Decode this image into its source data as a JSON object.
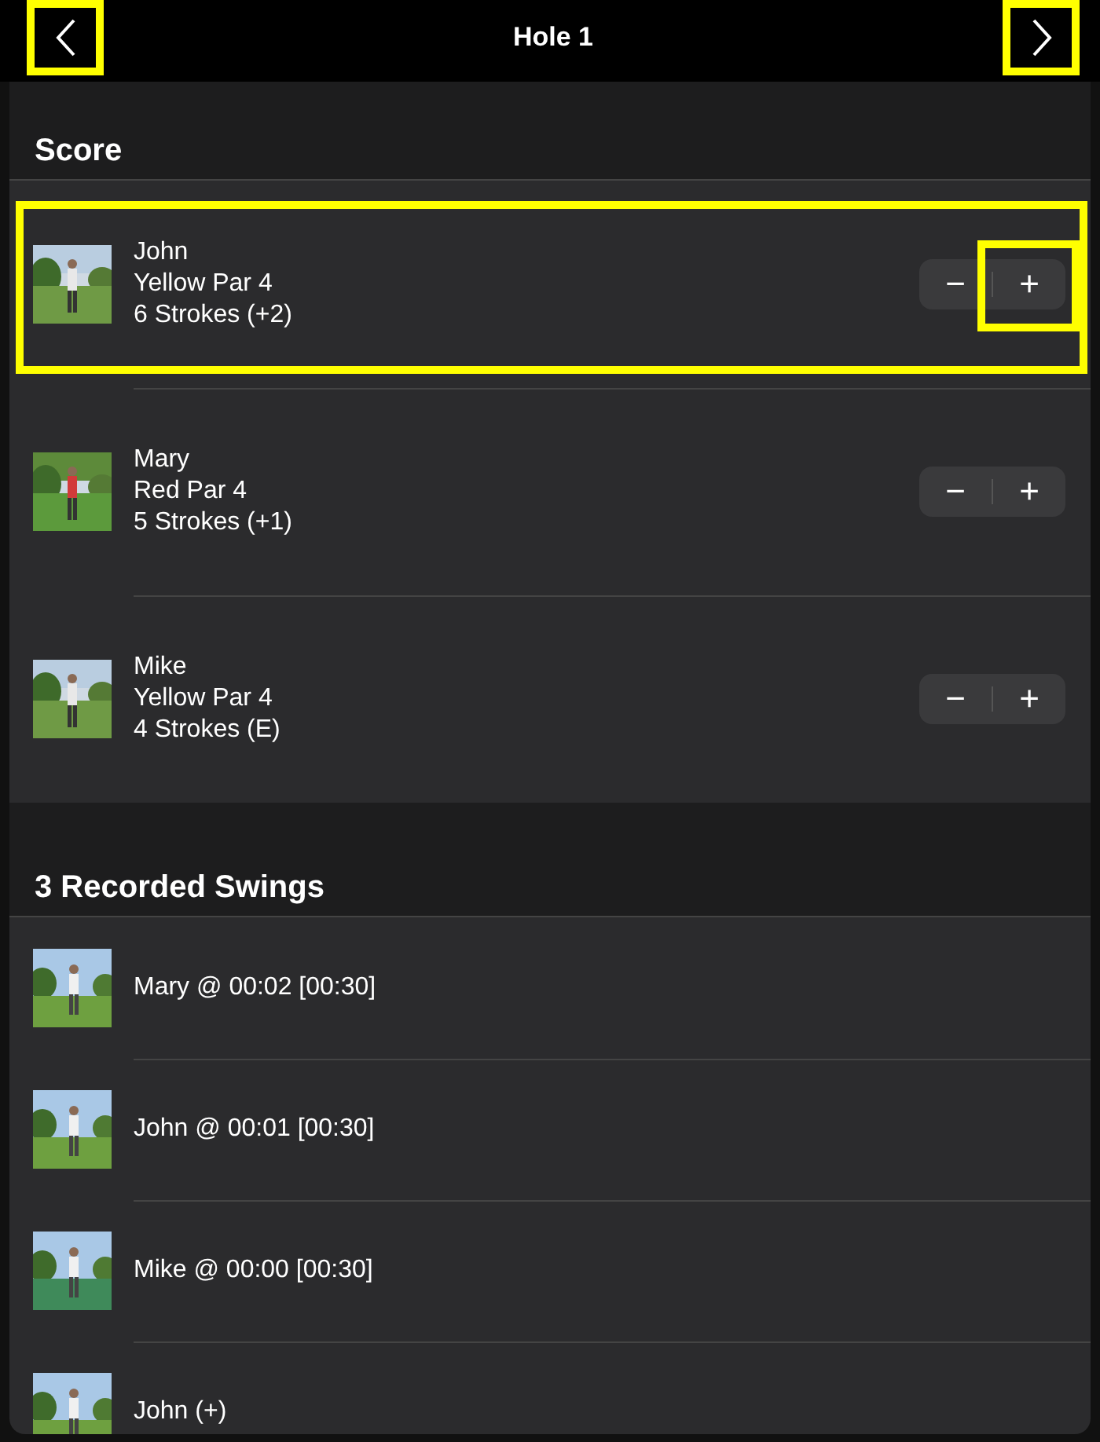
{
  "nav": {
    "title": "Hole 1",
    "back": {
      "highlighted": true
    },
    "forward": {
      "highlighted": true
    }
  },
  "score": {
    "title": "Score",
    "players": [
      {
        "name": "John",
        "tee": "Yellow Par 4",
        "strokes": "6 Strokes (+2)",
        "minus": "−",
        "plus": "+",
        "highlighted": true,
        "plus_highlighted": true
      },
      {
        "name": "Mary",
        "tee": "Red Par 4",
        "strokes": "5 Strokes (+1)",
        "minus": "−",
        "plus": "+",
        "highlighted": false,
        "plus_highlighted": false
      },
      {
        "name": "Mike",
        "tee": "Yellow Par 4",
        "strokes": "4 Strokes (E)",
        "minus": "−",
        "plus": "+",
        "highlighted": false,
        "plus_highlighted": false
      }
    ]
  },
  "swings": {
    "title": "3 Recorded Swings",
    "items": [
      {
        "label": "Mary @ 00:02 [00:30]"
      },
      {
        "label": "John @ 00:01 [00:30]"
      },
      {
        "label": "Mike @ 00:00 [00:30]"
      },
      {
        "label": "John (+)"
      }
    ]
  }
}
